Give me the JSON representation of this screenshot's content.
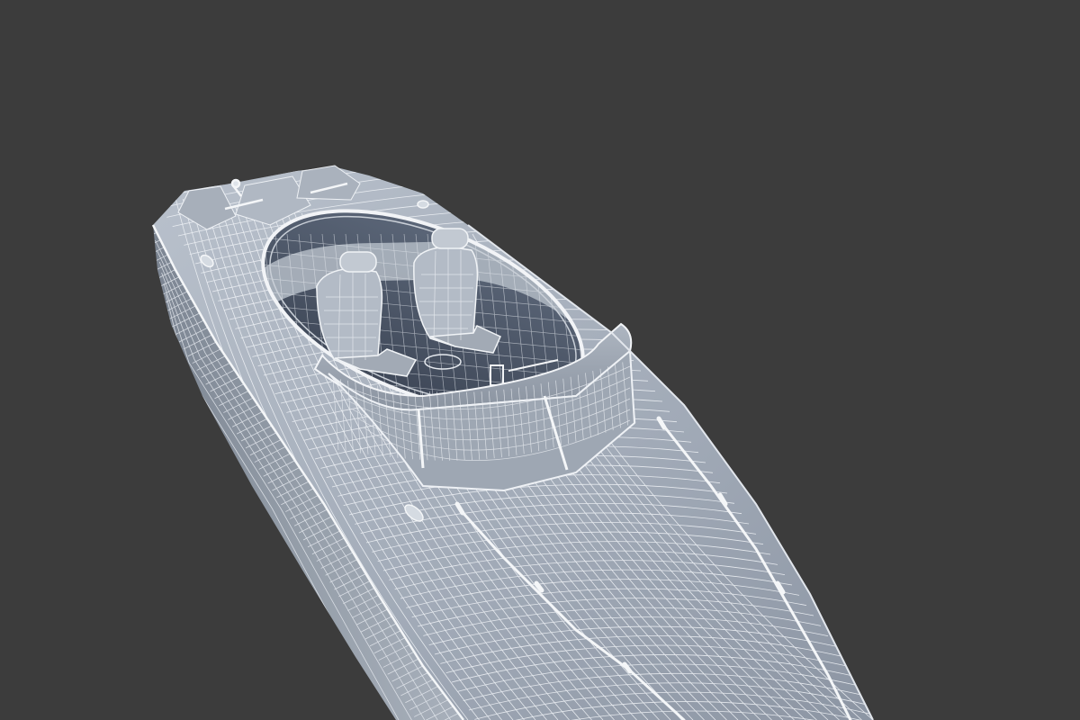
{
  "scene": {
    "subject": "speedboat-wireframe-render",
    "colors": {
      "background": "#3c3c3c",
      "hull_fill": "#9aa3b0",
      "hull_light": "#b4bcc7",
      "hull_shadow": "#6f7784",
      "wire": "#e9edf2",
      "cockpit_floor": "#4a5566",
      "rail": "#f4f6f8"
    }
  }
}
